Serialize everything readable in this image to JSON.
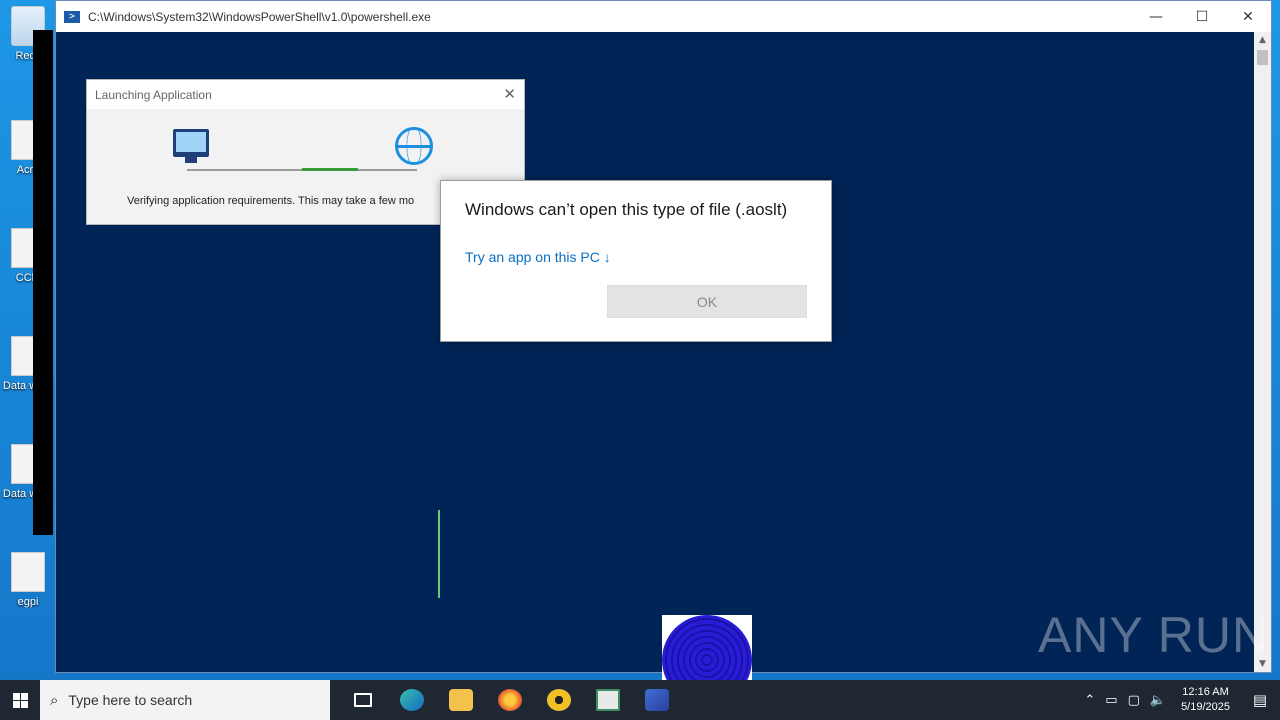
{
  "desktop": {
    "icons": [
      {
        "label": "Recy",
        "icon": "recycle-bin-icon"
      },
      {
        "label": "Acro",
        "icon": "acrobat-icon"
      },
      {
        "label": "CCle",
        "icon": "ccleaner-icon"
      },
      {
        "label": "Data warn",
        "icon": "document-icon"
      },
      {
        "label": "Data warn",
        "icon": "document-icon"
      },
      {
        "label": "egpi",
        "icon": "file-icon"
      }
    ]
  },
  "powershell": {
    "title": "C:\\Windows\\System32\\WindowsPowerShell\\v1.0\\powershell.exe",
    "icon": "powershell-icon",
    "minimize": "—",
    "maximize": "☐",
    "close": "✕",
    "background": "#012456"
  },
  "launch_dialog": {
    "title": "Launching Application",
    "close": "✕",
    "status": "Verifying application requirements. This may take a few mo"
  },
  "error_dialog": {
    "title": "Windows can’t open this type of file (.aoslt)",
    "link": "Try an app on this PC ↓",
    "ok": "OK"
  },
  "watermark": "ANY RUN",
  "taskbar": {
    "search_placeholder": "Type here to search",
    "apps": [
      "task-view-icon",
      "edge-icon",
      "file-explorer-icon",
      "firefox-icon",
      "nuclear-app-icon",
      "app-window-icon",
      "powershell-icon"
    ],
    "time": "12:16 AM",
    "date": "5/19/2025",
    "colors": {
      "bar": "#1f2732",
      "accent": "#0a6fc4"
    }
  }
}
